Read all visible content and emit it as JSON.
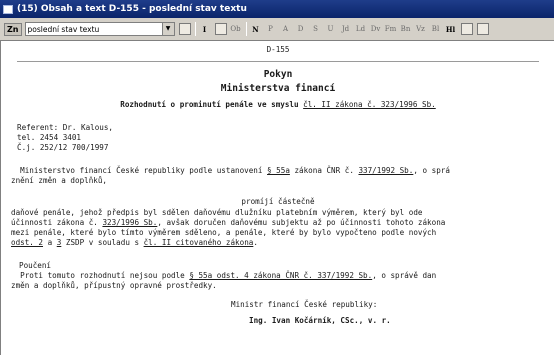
{
  "window": {
    "title": "(15) Obsah a text D-155 - poslední stav textu"
  },
  "toolbar": {
    "label": "Zn",
    "combo_value": "poslední stav textu",
    "buttons": [
      "Ob",
      "N",
      "P",
      "A",
      "D",
      "S",
      "U",
      "Jd",
      "Ld",
      "Dv",
      "Fm",
      "Bn",
      "Vz",
      "Bl",
      "Hl"
    ]
  },
  "document": {
    "code": "D-155",
    "kind": "Pokyn",
    "issuer": "Ministerstva financí",
    "subject_pre": "Rozhodnutí o prominutí penále ve smyslu ",
    "subject_link": "čl. II zákona č. 323/1996 Sb.",
    "referent": "Referent: Dr. Kalous,",
    "tel": "tel. 2454 3401",
    "cj": "Č.j. 252/12 700/1997",
    "p1_pre": "  Ministerstvo financí České republiky podle ustanovení ",
    "p1_link1": "§ 55a",
    "p1_mid": " zákona ČNR č. ",
    "p1_link2": "337/1992 Sb.",
    "p1_post": ", o sprá",
    "p1_line2": "znění změn a doplňků,",
    "promiji": "promíjí částečně",
    "p2_line1": "daňové penále, jehož předpis byl sdělen daňovému dlužníku platebním výměrem, který byl ode",
    "p2_line2_pre": "účinnosti zákona č. ",
    "p2_line2_link": "323/1996 Sb.",
    "p2_line2_post": ", avšak doručen daňovému subjektu až po účinnosti tohoto zákona",
    "p2_line3": "mezi penále, které bylo tímto výměrem sděleno, a penále, které by bylo vypočteno podle nových",
    "p2_line4_link1": "odst. 2",
    "p2_line4_a": " a ",
    "p2_line4_link2": "3",
    "p2_line4_mid": " ZSDP v souladu s ",
    "p2_line4_link3": "čl. II citovaného zákona",
    "p2_line4_post": ".",
    "pouceni": "Poučení",
    "p3_pre": "  Proti tomuto rozhodnutí nejsou podle ",
    "p3_link": "§ 55a odst. 4 zákona ČNR č. 337/1992 Sb.",
    "p3_post": ", o správě dan",
    "p3_line2": "změn a doplňků, přípustný opravné prostředky.",
    "signature_title": "Ministr financí České republiky:",
    "signature_name": "Ing. Ivan Kočárník, CSc., v. r."
  }
}
